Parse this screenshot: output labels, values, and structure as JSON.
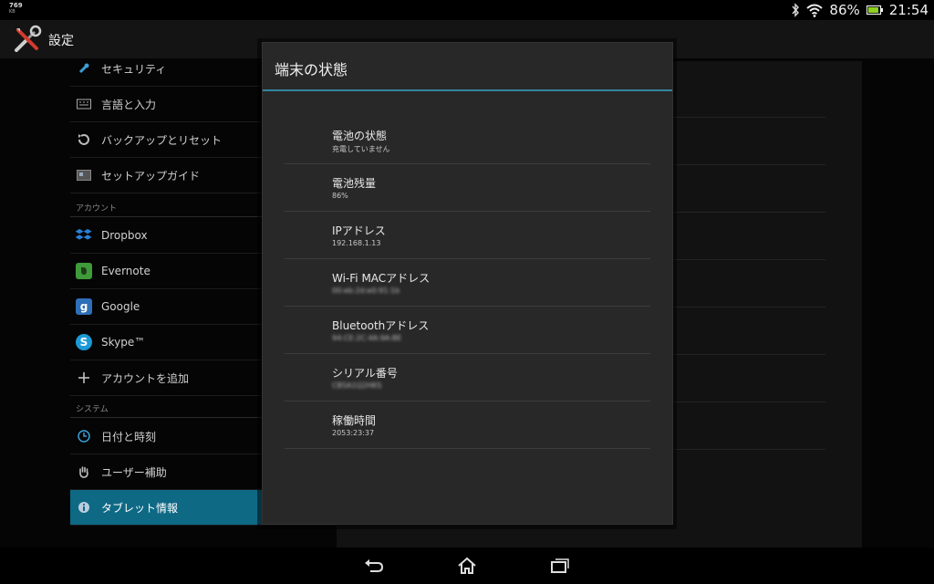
{
  "status_bar": {
    "net_speed": "769",
    "net_unit": "KB",
    "battery_percent": "86%",
    "time": "21:54"
  },
  "action_bar": {
    "title": "設定"
  },
  "sidebar": {
    "items_top": [
      {
        "label": "セキュリティ",
        "icon": "lock-icon"
      },
      {
        "label": "言語と入力",
        "icon": "keyboard-icon"
      },
      {
        "label": "バックアップとリセット",
        "icon": "restore-icon"
      },
      {
        "label": "セットアップガイド",
        "icon": "setup-guide-icon"
      }
    ],
    "accounts_header": "アカウント",
    "accounts": [
      {
        "label": "Dropbox",
        "icon": "dropbox-icon"
      },
      {
        "label": "Evernote",
        "icon": "evernote-icon"
      },
      {
        "label": "Google",
        "icon": "google-icon"
      },
      {
        "label": "Skype™",
        "icon": "skype-icon"
      },
      {
        "label": "アカウントを追加",
        "icon": "plus-icon"
      }
    ],
    "system_header": "システム",
    "system": [
      {
        "label": "日付と時刻",
        "icon": "clock-icon"
      },
      {
        "label": "ユーザー補助",
        "icon": "hand-icon"
      },
      {
        "label": "タブレット情報",
        "icon": "info-icon",
        "active": true
      }
    ]
  },
  "dialog": {
    "title": "端末の状態",
    "rows": [
      {
        "title": "電池の状態",
        "value": "充電していません"
      },
      {
        "title": "電池残量",
        "value": "86%"
      },
      {
        "title": "IPアドレス",
        "value": "192.168.1.13"
      },
      {
        "title": "Wi-Fi MACアドレス",
        "value": "00:eb:2d:e0:91:1b",
        "blurred": true
      },
      {
        "title": "Bluetoothアドレス",
        "value": "94:CE:2C:4A:9A:BE",
        "blurred": true
      },
      {
        "title": "シリアル番号",
        "value": "CB5A1Q2HKS",
        "blurred": true
      },
      {
        "title": "稼働時間",
        "value": "2053:23:37"
      }
    ]
  },
  "colors": {
    "accent": "#33869e",
    "active_item": "#0e6985",
    "battery": "#8bd01e"
  }
}
